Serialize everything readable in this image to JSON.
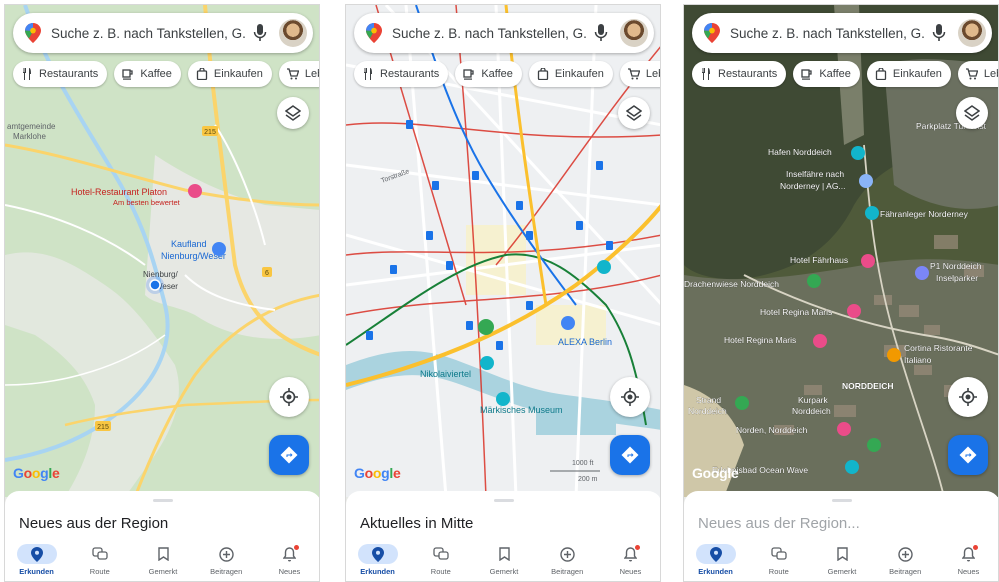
{
  "search": {
    "placeholder": "Suche z. B. nach Tankstellen, G..."
  },
  "chips": [
    {
      "label": "Restaurants",
      "icon": "fork-knife-icon"
    },
    {
      "label": "Kaffee",
      "icon": "coffee-icon"
    },
    {
      "label": "Einkaufen",
      "icon": "shopping-bag-icon"
    },
    {
      "label": "Leb",
      "icon": "cart-icon"
    }
  ],
  "logo": [
    "G",
    "o",
    "o",
    "g",
    "l",
    "e"
  ],
  "nav": [
    {
      "label": "Erkunden",
      "icon": "pin-icon"
    },
    {
      "label": "Route",
      "icon": "commute-icon"
    },
    {
      "label": "Gemerkt",
      "icon": "bookmark-icon"
    },
    {
      "label": "Beitragen",
      "icon": "add-circle-icon"
    },
    {
      "label": "Neues",
      "icon": "bell-icon"
    }
  ],
  "screens": [
    {
      "sheet_title": "Neues aus der Region",
      "labels": {
        "amt": "amtgemeinde",
        "marklohe": "Marklohe",
        "hotel": "Hotel-Restaurant Platon",
        "hotel_sub": "Am besten bewertet",
        "kaufland": "Kaufland",
        "kaufland2": "Nienburg/Weser",
        "city": "Nienburg/",
        "city2": "Weser",
        "r215a": "215",
        "r215b": "215",
        "r6": "6"
      }
    },
    {
      "sheet_title": "Aktuelles in Mitte",
      "labels": {
        "torstr": "Torstraße",
        "alexa": "ALEXA Berlin",
        "nikolai": "Nikolaiviertel",
        "maerkisches": "Märkisches Museum",
        "scale1": "1000 ft",
        "scale2": "200 m"
      }
    },
    {
      "sheet_title": "Neues aus der Region...",
      "labels": {
        "hafen": "Hafen Norddeich",
        "parkplatz": "Parkplatz Tunnelst",
        "insel1": "Inselfähre nach",
        "insel2": "Norderney | AG...",
        "faehr": "Fähranleger Norderney",
        "fahrhaus": "Hotel Fährhaus",
        "drachen": "Drachenwiese Norddeich",
        "p1a": "P1 Norddeich",
        "p1b": "Inselparker",
        "regina1": "Hotel Regina Maris",
        "regina2": "Hotel Regina Maris",
        "cortina1": "Cortina Ristorante",
        "cortina2": "Italiano",
        "norddeich": "NORDDEICH",
        "kurpark1": "Kurpark",
        "kurpark2": "Norddeich",
        "strand1": "Strand",
        "strand2": "Norddeich",
        "norden": "Norden, Norddeich",
        "ocean": "Erlebnisbad Ocean Wave"
      }
    }
  ]
}
